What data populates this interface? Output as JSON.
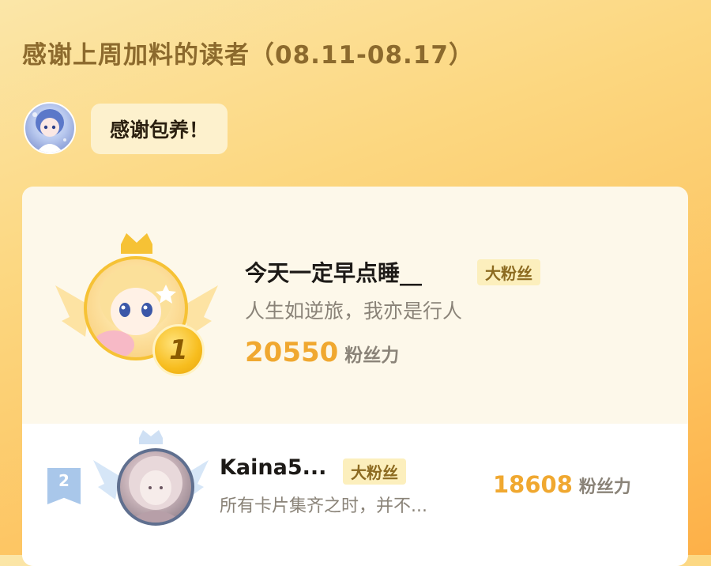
{
  "header": {
    "title": "感谢上周加料的读者（08.11-08.17）"
  },
  "author": {
    "message": "感谢包养！"
  },
  "ranking": [
    {
      "rank": "1",
      "name": "今天一定早点睡__",
      "badge": "大粉丝",
      "motto": "人生如逆旅，我亦是行人",
      "score": "20550",
      "score_label": "粉丝力"
    },
    {
      "rank": "2",
      "name": "Kaina5...",
      "badge": "大粉丝",
      "motto": "所有卡片集齐之时，并不...",
      "score": "18608",
      "score_label": "粉丝力"
    }
  ],
  "colors": {
    "accent": "#f0a830",
    "gold": "#f6c235",
    "silver": "#a9c7ea"
  }
}
